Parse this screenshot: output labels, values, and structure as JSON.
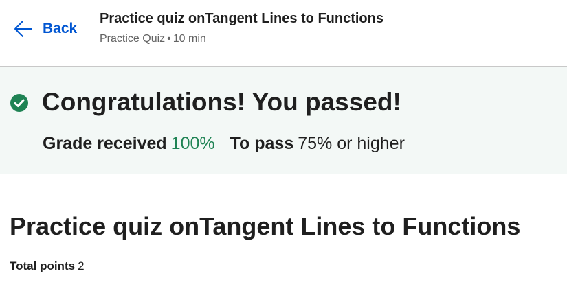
{
  "header": {
    "back_label": "Back",
    "title": "Practice quiz onTangent Lines to Functions",
    "quiz_type": "Practice Quiz",
    "separator": "•",
    "duration": "10 min"
  },
  "result_banner": {
    "status_icon": "check-circle-icon",
    "message": "Congratulations! You passed!",
    "grade_label": "Grade received",
    "grade_value": "100%",
    "pass_label": "To pass",
    "pass_value": "75% or higher"
  },
  "main": {
    "title": "Practice quiz onTangent Lines to Functions",
    "total_points_label": "Total points",
    "total_points_value": "2"
  },
  "colors": {
    "accent": "#0056d2",
    "success": "#1f8354",
    "banner_bg": "#f3f8f6",
    "text": "#1f1f1f"
  }
}
